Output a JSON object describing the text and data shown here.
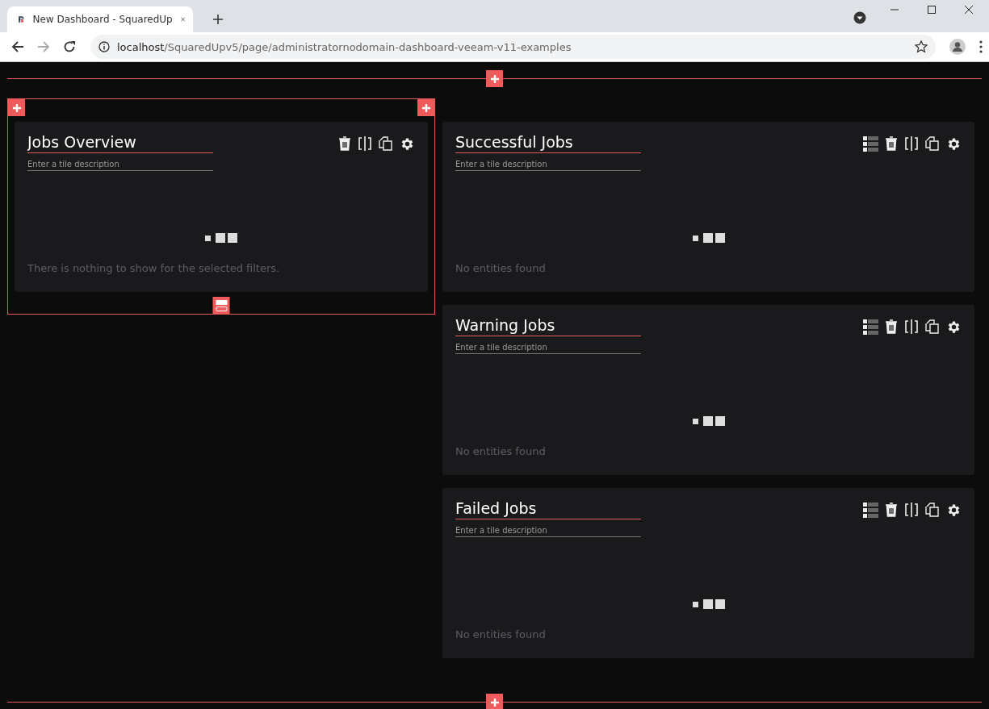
{
  "browser": {
    "tab_title": "New Dashboard - SquaredUp",
    "url_host": "localhost",
    "url_path": "/SquaredUpv5/page/administratornodomain-dashboard-veeam-v11-examples"
  },
  "columns": [
    {
      "tiles": [
        {
          "kind": "summary",
          "title": "Jobs Overview",
          "description_placeholder": "Enter a tile description",
          "message": "There is nothing to show for the selected filters.",
          "selected": true
        }
      ]
    },
    {
      "tiles": [
        {
          "kind": "list",
          "title": "Successful Jobs",
          "description_placeholder": "Enter a tile description",
          "message": "No entities found",
          "selected": false
        },
        {
          "kind": "list",
          "title": "Warning Jobs",
          "description_placeholder": "Enter a tile description",
          "message": "No entities found",
          "selected": false
        },
        {
          "kind": "list",
          "title": "Failed Jobs",
          "description_placeholder": "Enter a tile description",
          "message": "No entities found",
          "selected": false
        }
      ]
    }
  ]
}
